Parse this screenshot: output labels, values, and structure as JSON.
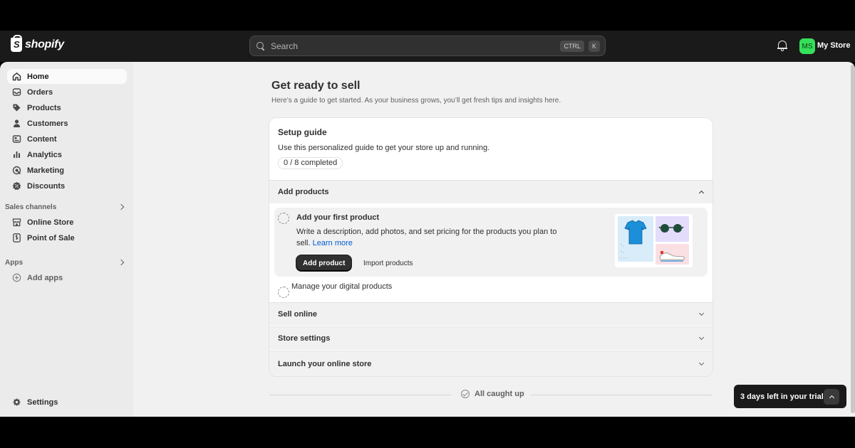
{
  "brand": {
    "name": "shopify"
  },
  "search": {
    "placeholder": "Search",
    "shortcut_mod": "CTRL",
    "shortcut_key": "K"
  },
  "account": {
    "initials": "MS",
    "store_name": "My Store",
    "avatar_color": "#36e05a"
  },
  "sidebar": {
    "items": [
      {
        "label": "Home",
        "icon": "home-icon",
        "active": true
      },
      {
        "label": "Orders",
        "icon": "inbox-icon"
      },
      {
        "label": "Products",
        "icon": "tag-icon"
      },
      {
        "label": "Customers",
        "icon": "person-icon"
      },
      {
        "label": "Content",
        "icon": "content-icon"
      },
      {
        "label": "Analytics",
        "icon": "bar-chart-icon"
      },
      {
        "label": "Marketing",
        "icon": "target-icon"
      },
      {
        "label": "Discounts",
        "icon": "discount-icon"
      }
    ],
    "sales_channels": {
      "title": "Sales channels",
      "items": [
        {
          "label": "Online Store",
          "icon": "store-icon"
        },
        {
          "label": "Point of Sale",
          "icon": "pos-icon"
        }
      ]
    },
    "apps": {
      "title": "Apps",
      "add_label": "Add apps"
    },
    "settings_label": "Settings"
  },
  "page": {
    "title": "Get ready to sell",
    "subtitle": "Here’s a guide to get started. As your business grows, you’ll get fresh tips and insights here."
  },
  "setup_guide": {
    "title": "Setup guide",
    "description": "Use this personalized guide to get your store up and running.",
    "progress_text": "0 / 8 completed",
    "progress": {
      "completed": 0,
      "total": 8
    },
    "sections": [
      {
        "label": "Add products",
        "expanded": true
      },
      {
        "label": "Sell online",
        "expanded": false
      },
      {
        "label": "Store settings",
        "expanded": false
      },
      {
        "label": "Launch your online store",
        "expanded": false
      }
    ],
    "add_products": {
      "task1": {
        "title": "Add your first product",
        "description": "Write a description, add photos, and set pricing for the products you plan to sell.",
        "learn_more": "Learn more",
        "primary_button": "Add product",
        "secondary_button": "Import products"
      },
      "task2": {
        "title": "Manage your digital products"
      }
    }
  },
  "footer": {
    "caught_up": "All caught up"
  },
  "trial": {
    "label": "3 days left in your trial"
  }
}
